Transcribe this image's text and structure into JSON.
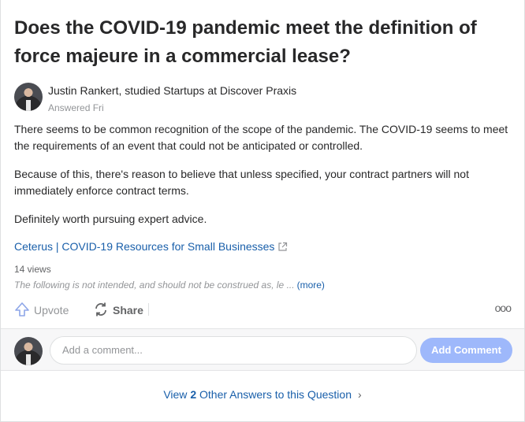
{
  "question": {
    "title": "Does the COVID-19 pandemic meet the definition of force majeure in a commercial lease?"
  },
  "answer": {
    "author": "Justin Rankert, studied Startups at Discover Praxis",
    "answered": "Answered Fri",
    "paragraphs": [
      "There seems to be common recognition of the scope of the pandemic. The COVID-19 seems to meet the requirements of an event that could not be anticipated or controlled.",
      "Because of this, there's reason to believe that unless specified, your contract partners will not immediately enforce contract terms.",
      "Definitely worth pursuing expert advice."
    ],
    "link_text": "Ceterus | COVID-19 Resources for Small Businesses",
    "views": "14 views",
    "disclaimer": "The following is not intended, and should not be construed as, le ...",
    "more_label": "(more)"
  },
  "actions": {
    "upvote_label": "Upvote",
    "share_label": "Share",
    "overflow_label": "ooo"
  },
  "comment": {
    "placeholder": "Add a comment...",
    "button_label": "Add Comment"
  },
  "footer": {
    "prefix": "View",
    "count": "2",
    "suffix": "Other Answers to this Question"
  },
  "colors": {
    "link": "#195faa",
    "button_disabled": "#9eb8fb",
    "muted": "#939598"
  }
}
